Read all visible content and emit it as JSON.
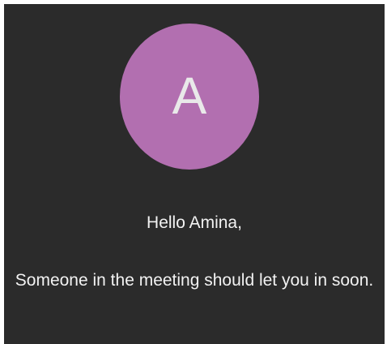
{
  "avatar": {
    "initial": "A",
    "color": "#b26fb0"
  },
  "greeting": "Hello Amina,",
  "message": "Someone in the meeting should let you in soon.",
  "colors": {
    "background": "#2b2b2b",
    "text": "#f2f2f2"
  }
}
